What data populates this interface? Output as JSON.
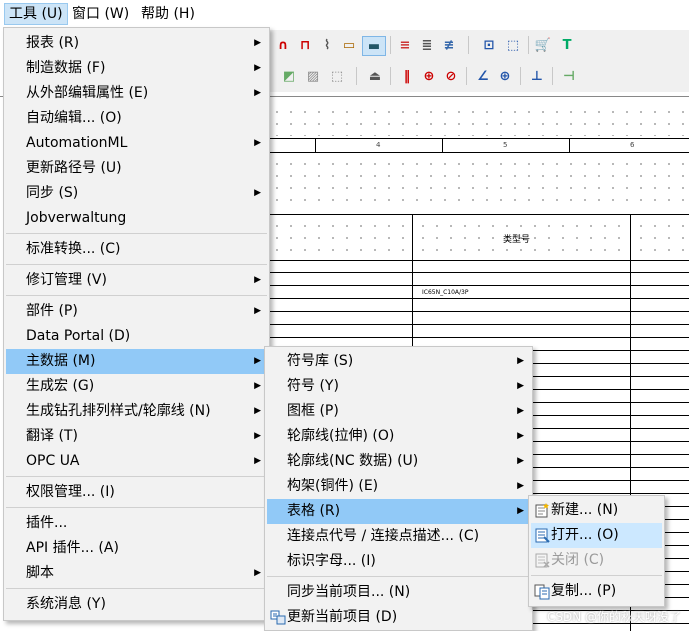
{
  "menubar": {
    "items": [
      {
        "label": "工具 (U)",
        "active": true
      },
      {
        "label": "窗口 (W)"
      },
      {
        "label": "帮助 (H)"
      }
    ]
  },
  "main_menu": {
    "items": [
      {
        "label": "报表 (R)",
        "submenu": true
      },
      {
        "label": "制造数据 (F)",
        "submenu": true
      },
      {
        "label": "从外部编辑属性 (E)",
        "submenu": true
      },
      {
        "label": "自动编辑... (O)"
      },
      {
        "label": "AutomationML",
        "submenu": true
      },
      {
        "label": "更新路径号 (U)"
      },
      {
        "label": "同步 (S)",
        "submenu": true
      },
      {
        "label": "Jobverwaltung"
      },
      {
        "label": "标准转换... (C)"
      },
      {
        "label": "修订管理 (V)",
        "submenu": true
      },
      {
        "label": "部件 (P)",
        "submenu": true
      },
      {
        "label": "Data Portal (D)"
      },
      {
        "label": "主数据 (M)",
        "submenu": true,
        "highlighted": true
      },
      {
        "label": "生成宏 (G)",
        "submenu": true
      },
      {
        "label": "生成钻孔排列样式/轮廓线 (N)",
        "submenu": true
      },
      {
        "label": "翻译 (T)",
        "submenu": true
      },
      {
        "label": "OPC UA",
        "submenu": true
      },
      {
        "label": "权限管理... (I)"
      },
      {
        "label": "插件..."
      },
      {
        "label": "API 插件... (A)"
      },
      {
        "label": "脚本",
        "submenu": true
      },
      {
        "label": "系统消息 (Y)"
      }
    ]
  },
  "master_data_menu": {
    "items": [
      {
        "label": "符号库 (S)",
        "submenu": true
      },
      {
        "label": "符号 (Y)",
        "submenu": true
      },
      {
        "label": "图框 (P)",
        "submenu": true
      },
      {
        "label": "轮廓线(拉伸) (O)",
        "submenu": true
      },
      {
        "label": "轮廓线(NC 数据) (U)",
        "submenu": true
      },
      {
        "label": "构架(铜件) (E)",
        "submenu": true
      },
      {
        "label": "表格 (R)",
        "submenu": true,
        "highlighted": true
      },
      {
        "label": "连接点代号 / 连接点描述... (C)"
      },
      {
        "label": "标识字母... (I)"
      },
      {
        "label": "同步当前项目... (N)"
      },
      {
        "label": "更新当前项目 (D)",
        "icon": "update-project-icon"
      }
    ]
  },
  "forms_menu": {
    "items": [
      {
        "label": "新建... (N)",
        "icon": "new-form-icon"
      },
      {
        "label": "打开... (O)",
        "icon": "open-form-icon",
        "highlighted": true
      },
      {
        "label": "关闭 (C)",
        "icon": "close-form-icon",
        "disabled": true
      },
      {
        "label": "复制... (P)",
        "icon": "copy-form-icon"
      }
    ]
  },
  "canvas": {
    "column_numbers": [
      "4",
      "5",
      "6"
    ],
    "header_label": "类型号",
    "part_number": "IC65N_C10A/3P"
  },
  "watermark": "CSDN @你的秋天呀没了",
  "colors": {
    "highlight": "#91c9f7",
    "menu_bg": "#f2f2f2",
    "menubar_active": "#cce4f7"
  }
}
